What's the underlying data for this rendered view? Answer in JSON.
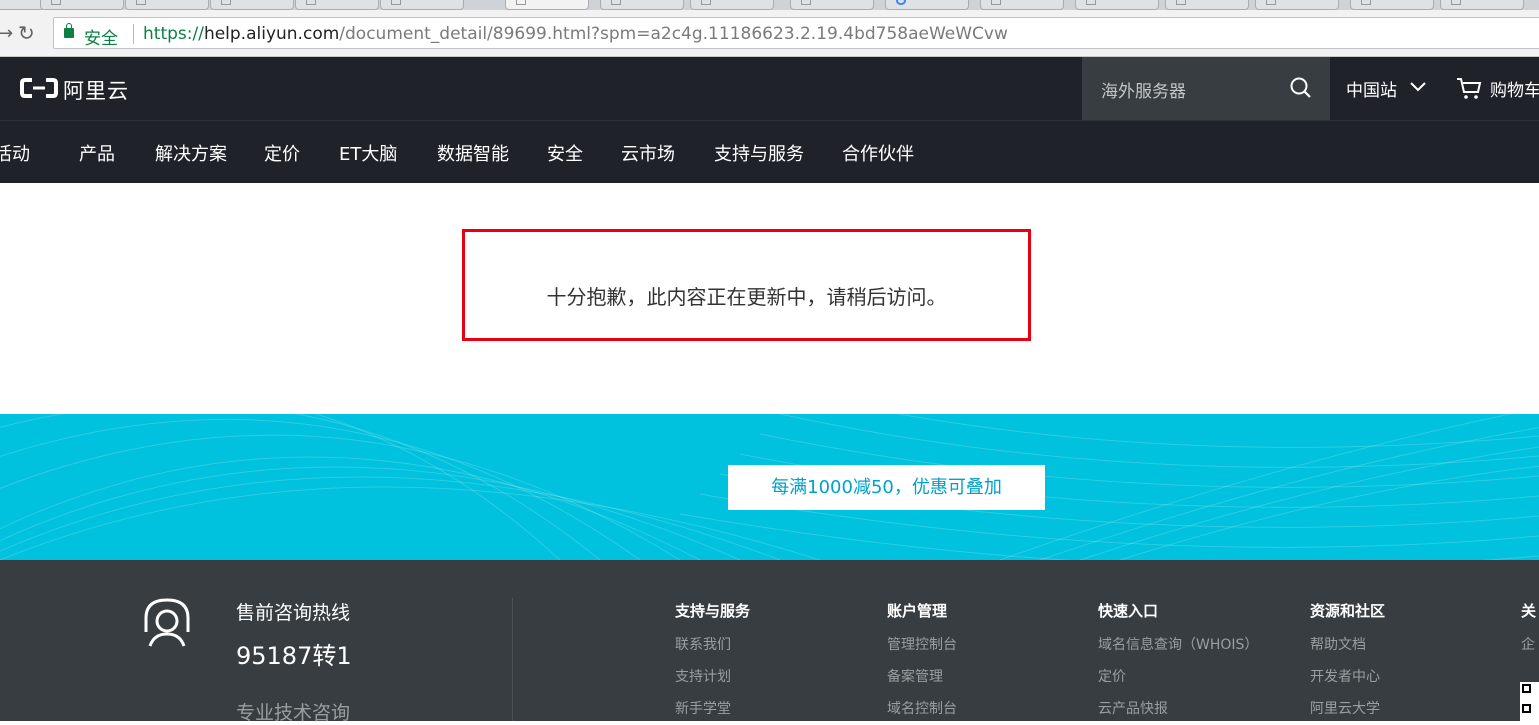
{
  "browser": {
    "secure_label": "安全",
    "url_scheme": "https://",
    "url_host": "help.aliyun.com",
    "url_path": "/document_detail/89699.html?spm=a2c4g.11186623.2.19.4bd758aeWeWCvw"
  },
  "header": {
    "logo_text": "阿里云",
    "search_placeholder": "海外服务器",
    "site_select": "中国站",
    "cart_label": "购物车"
  },
  "nav": {
    "items": [
      "活动",
      "产品",
      "解决方案",
      "定价",
      "ET大脑",
      "数据智能",
      "安全",
      "云市场",
      "支持与服务",
      "合作伙伴"
    ]
  },
  "main": {
    "notice": "十分抱歉，此内容正在更新中，请稍后访问。"
  },
  "banner": {
    "promo_button": "每满1000减50，优惠可叠加",
    "bg_color": "#00c1de"
  },
  "footer": {
    "hotline_title": "售前咨询热线",
    "hotline_number": "95187转1",
    "hotline_sub": "专业技术咨询",
    "columns": [
      {
        "title": "支持与服务",
        "links": [
          "联系我们",
          "支持计划",
          "新手学堂"
        ]
      },
      {
        "title": "账户管理",
        "links": [
          "管理控制台",
          "备案管理",
          "域名控制台"
        ]
      },
      {
        "title": "快速入口",
        "links": [
          "域名信息查询（WHOIS）",
          "定价",
          "云产品快报"
        ]
      },
      {
        "title": "资源和社区",
        "links": [
          "帮助文档",
          "开发者中心",
          "阿里云大学"
        ]
      },
      {
        "title": "关",
        "links": [
          "企"
        ]
      }
    ]
  }
}
